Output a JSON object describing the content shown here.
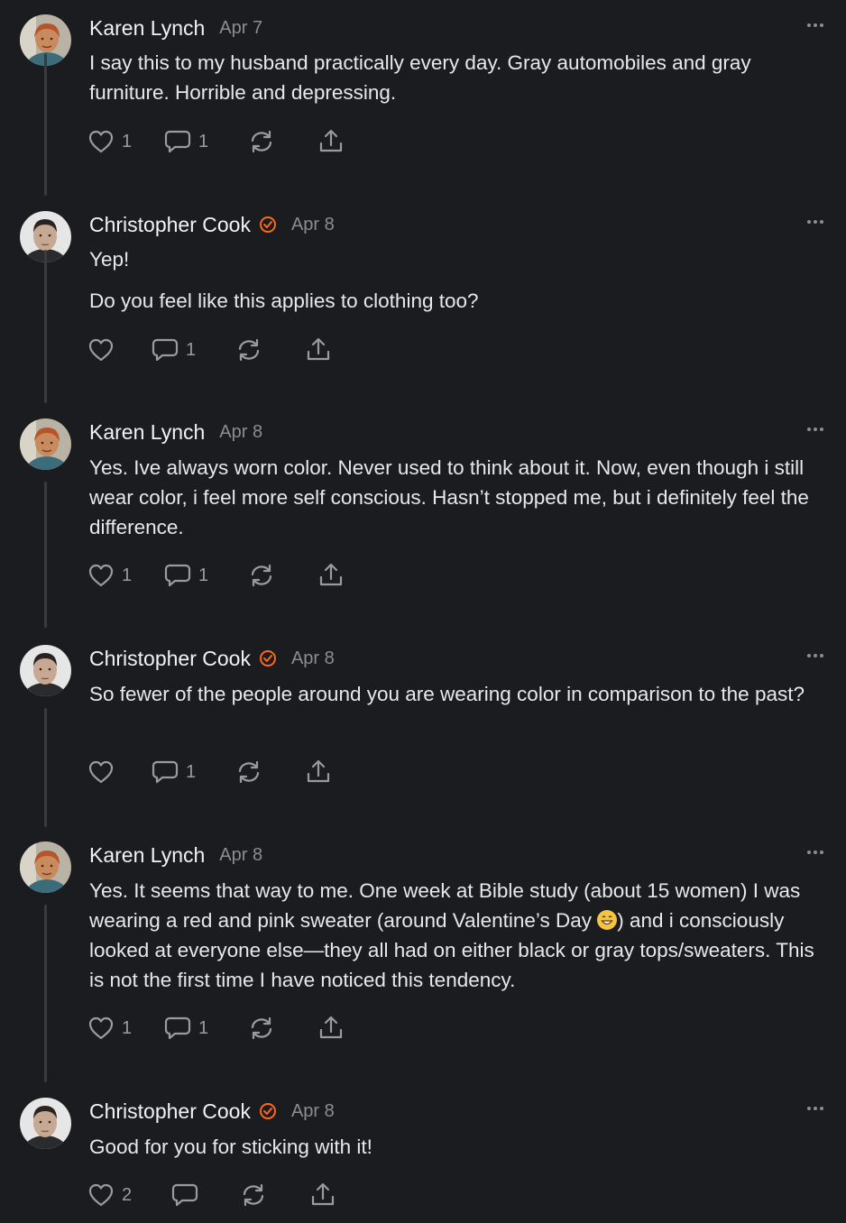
{
  "comments": [
    {
      "author": "Karen Lynch",
      "date": "Apr 7",
      "verified": false,
      "paragraphs": [
        "I say this to my husband practically every day. Gray automobiles and gray furniture. Horrible and depressing."
      ],
      "likes": "1",
      "replies": "1"
    },
    {
      "author": "Christopher Cook",
      "date": "Apr 8",
      "verified": true,
      "paragraphs": [
        "Yep!",
        "Do you feel like this applies to clothing too?"
      ],
      "likes": "",
      "replies": "1"
    },
    {
      "author": "Karen Lynch",
      "date": "Apr 8",
      "verified": false,
      "paragraphs": [
        "Yes. Ive always worn color. Never used to think about it. Now, even though i still wear color, i feel more self conscious. Hasn’t stopped me, but i definitely feel the difference."
      ],
      "likes": "1",
      "replies": "1"
    },
    {
      "author": "Christopher Cook",
      "date": "Apr 8",
      "verified": true,
      "paragraphs": [
        "So fewer of the people around you are wearing color in comparison to the past?"
      ],
      "likes": "",
      "replies": "1"
    },
    {
      "author": "Karen Lynch",
      "date": "Apr 8",
      "verified": false,
      "paragraphs_parts": {
        "before_emoji": "Yes. It seems that way to me. One week at Bible study (about 15 women) I was wearing a red and pink sweater (around Valentine’s Day ",
        "after_emoji": ") and i consciously looked at everyone else—they all had on either black or gray tops/sweaters. This is not the first time I have noticed this tendency."
      },
      "likes": "1",
      "replies": "1"
    },
    {
      "author": "Christopher Cook",
      "date": "Apr 8",
      "verified": true,
      "paragraphs": [
        "Good for you for sticking with it!"
      ],
      "likes": "2",
      "replies": ""
    }
  ],
  "icons": {
    "like": "heart-icon",
    "reply": "comment-icon",
    "restack": "restack-icon",
    "share": "share-icon",
    "more": "more-icon",
    "verified": "verified-badge-icon",
    "emoji": "grinning-face-emoji"
  },
  "colors": {
    "background": "#1b1c1f",
    "text": "#e8e8ea",
    "muted": "#8c8d92",
    "verified": "#ff6719",
    "thread": "#3a3b3f"
  }
}
